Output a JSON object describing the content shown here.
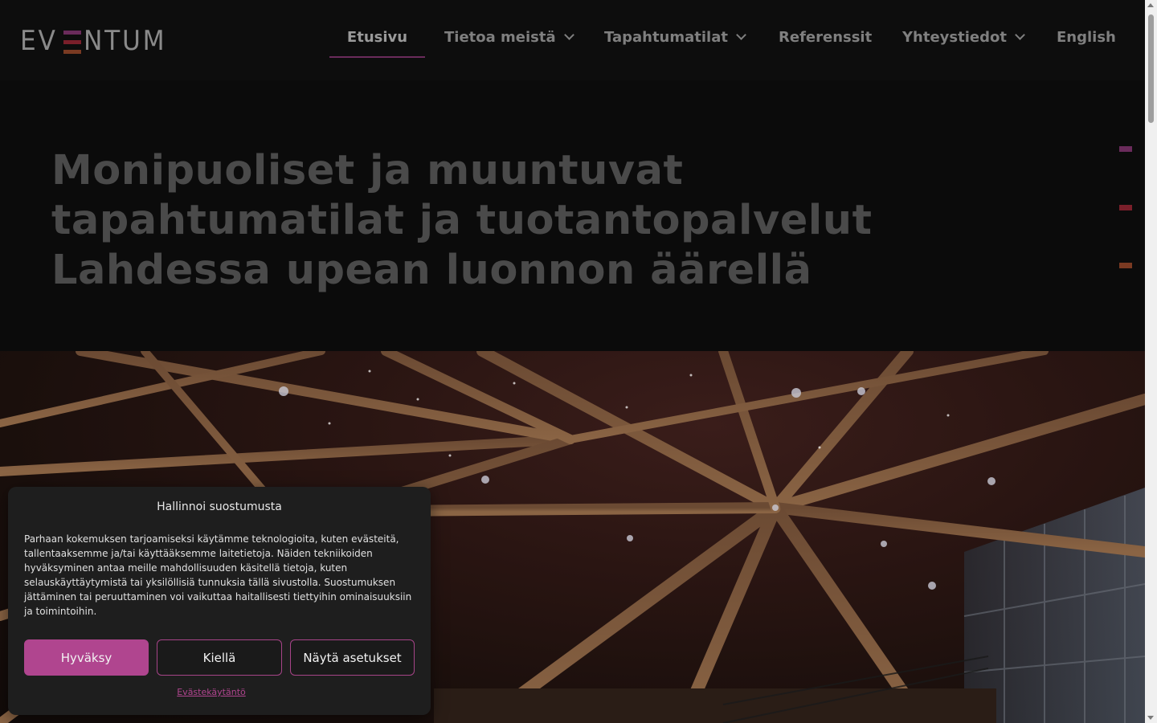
{
  "brand": {
    "logo_left": "EV",
    "logo_right": "NTUM"
  },
  "nav": {
    "items": [
      {
        "label": "Etusivu",
        "active": true,
        "dropdown": false
      },
      {
        "label": "Tietoa meistä",
        "active": false,
        "dropdown": true
      },
      {
        "label": "Tapahtumatilat",
        "active": false,
        "dropdown": true
      },
      {
        "label": "Referenssit",
        "active": false,
        "dropdown": false
      },
      {
        "label": "Yhteystiedot",
        "active": false,
        "dropdown": true
      },
      {
        "label": "English",
        "active": false,
        "dropdown": false
      }
    ]
  },
  "hero": {
    "headline_line1": "Monipuoliset ja muuntuvat",
    "headline_line2": "tapahtumatilat ja tuotantopalvelut",
    "headline_line3": "Lahdessa upean luonnon äärellä"
  },
  "consent": {
    "title": "Hallinnoi suostumusta",
    "body": "Parhaan kokemuksen tarjoamiseksi käytämme teknologioita, kuten evästeitä, tallentaaksemme ja/tai käyttääksemme laitetietoja. Näiden tekniikoiden hyväksyminen antaa meille mahdollisuuden käsitellä tietoja, kuten selauskäyttäytymistä tai yksilöllisiä tunnuksia tällä sivustolla. Suostumuksen jättäminen tai peruuttaminen voi vaikuttaa haitallisesti tiettyihin ominaisuuksiin ja toimintoihin.",
    "accept_label": "Hyväksy",
    "deny_label": "Kiellä",
    "settings_label": "Näytä asetukset",
    "policy_link": "Evästekäytäntö"
  },
  "colors": {
    "accent": "#b0458f",
    "brand_purple": "#6a2b5b",
    "brand_red": "#7a1f2a",
    "brand_orange": "#7a3a22",
    "background": "#0b0b0b"
  }
}
